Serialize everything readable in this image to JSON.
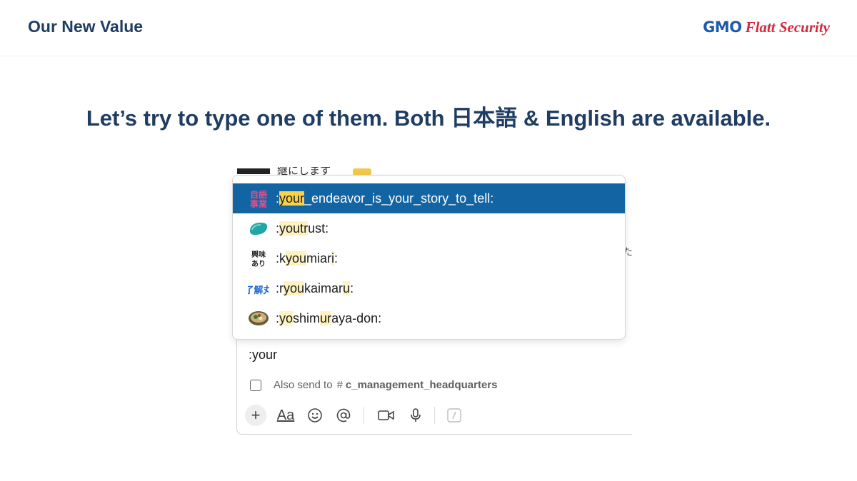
{
  "header": {
    "title": "Our New Value",
    "logo_gmo": "GMO",
    "logo_brand": "Flatt Security"
  },
  "headline": "Let’s try to type one of them. Both 日本語 & English are available.",
  "background_message": {
    "text": "継にします",
    "side_char": "た"
  },
  "autocomplete": {
    "items": [
      {
        "pre": ":",
        "match": "your",
        "post": "_endeavor_is_your_story_to_tell:",
        "icon": "jisho-jigyo-kanji-emoji",
        "icon_text": "自語事業",
        "selected": true
      },
      {
        "parts": [
          ":",
          "you",
          "t",
          "r",
          "ust:"
        ],
        "icon": "teal-blob-emoji"
      },
      {
        "parts": [
          ":k",
          "you",
          "miar",
          "i",
          ":"
        ],
        "icon": "kyoumi-ari-emoji",
        "icon_text": "興味あり"
      },
      {
        "parts": [
          ":r",
          "you",
          "kaimar",
          "u",
          ":"
        ],
        "icon": "ryoukai-maru-emoji",
        "icon_text": "了解丸"
      },
      {
        "parts": [
          ":",
          "yo",
          "shim",
          "ur",
          "aya-don:"
        ],
        "icon": "food-bowl-emoji"
      }
    ]
  },
  "composer": {
    "input_value": ":your",
    "also_send_label": "Also send to",
    "also_send_hash": "#",
    "also_send_channel": "c_management_headquarters",
    "checkbox_checked": false
  },
  "toolbar": {
    "plus": "+",
    "format": "Aa",
    "icons": [
      "plus-icon",
      "format-text-icon",
      "emoji-icon",
      "mention-icon",
      "video-icon",
      "microphone-icon",
      "slash-command-icon"
    ]
  },
  "colors": {
    "title": "#1f3d63",
    "selected_row": "#1264a3",
    "match_highlight": "#fdf2c0",
    "logo_gmo": "#1f5aa8",
    "logo_brand": "#d7283c"
  }
}
